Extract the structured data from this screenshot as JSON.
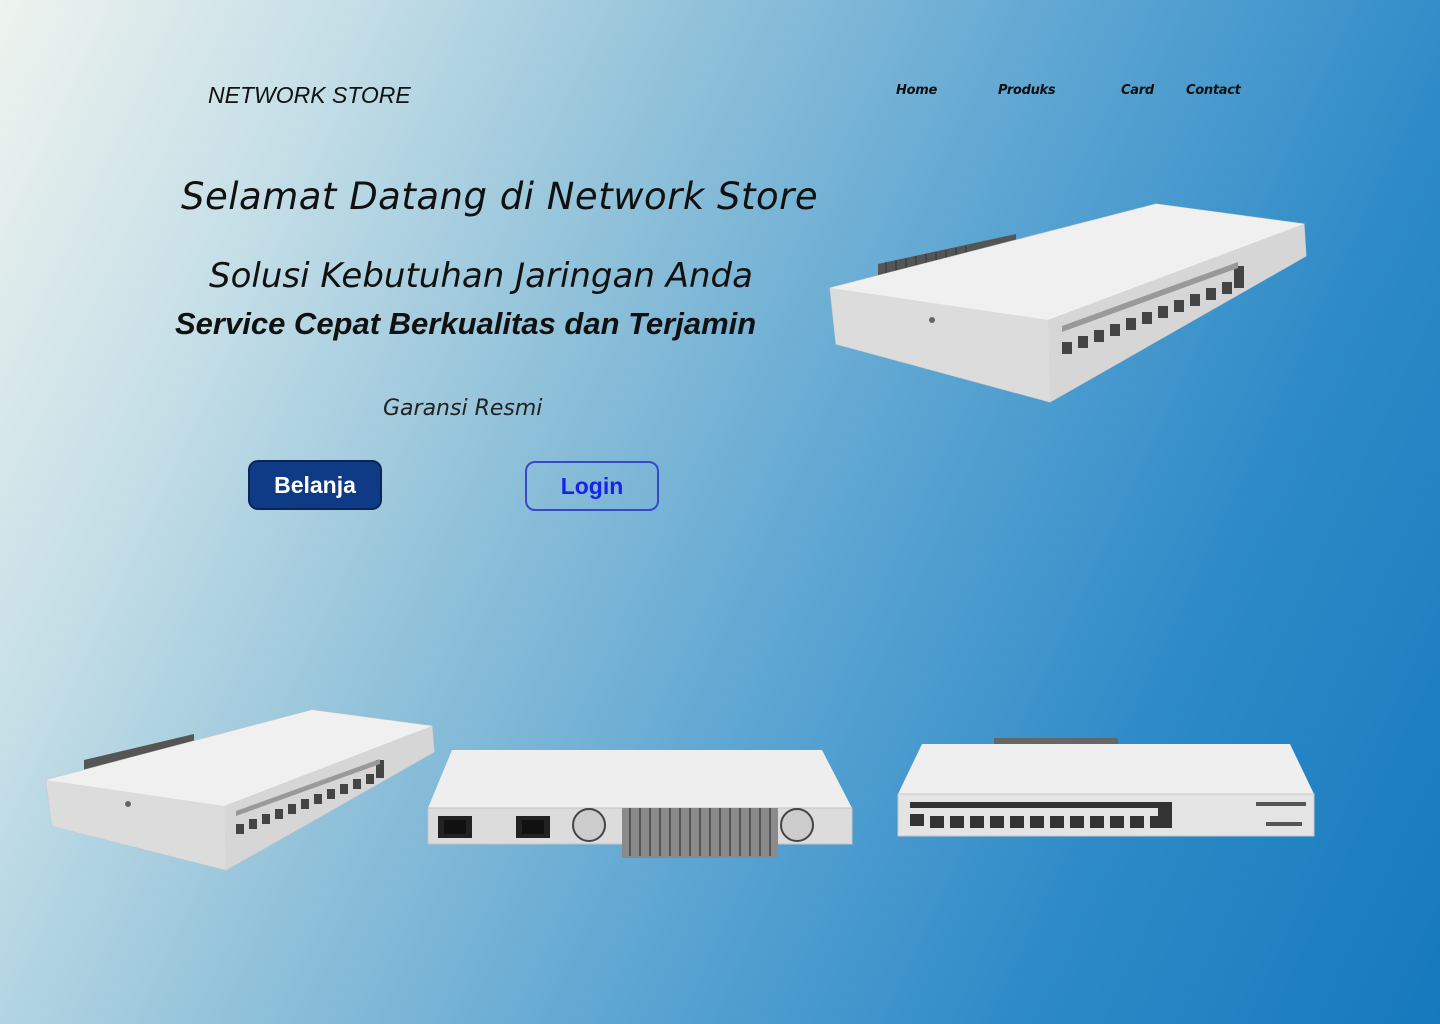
{
  "header": {
    "brand": "NETWORK STORE"
  },
  "nav": {
    "home": "Home",
    "products": "Produks",
    "card": "Card",
    "contact": "Contact"
  },
  "hero": {
    "title": "Selamat Datang di  Network Store",
    "subtitle": "Solusi Kebutuhan Jaringan Anda",
    "tagline": "Service Cepat Berkualitas dan Terjamin",
    "warranty": "Garansi Resmi",
    "shop_label": "Belanja",
    "login_label": "Login"
  },
  "colors": {
    "primary_button": "#0f3a86",
    "login_text": "#1a22e8",
    "bg_end": "#1679bd"
  },
  "icons": {
    "product": "router-image"
  }
}
